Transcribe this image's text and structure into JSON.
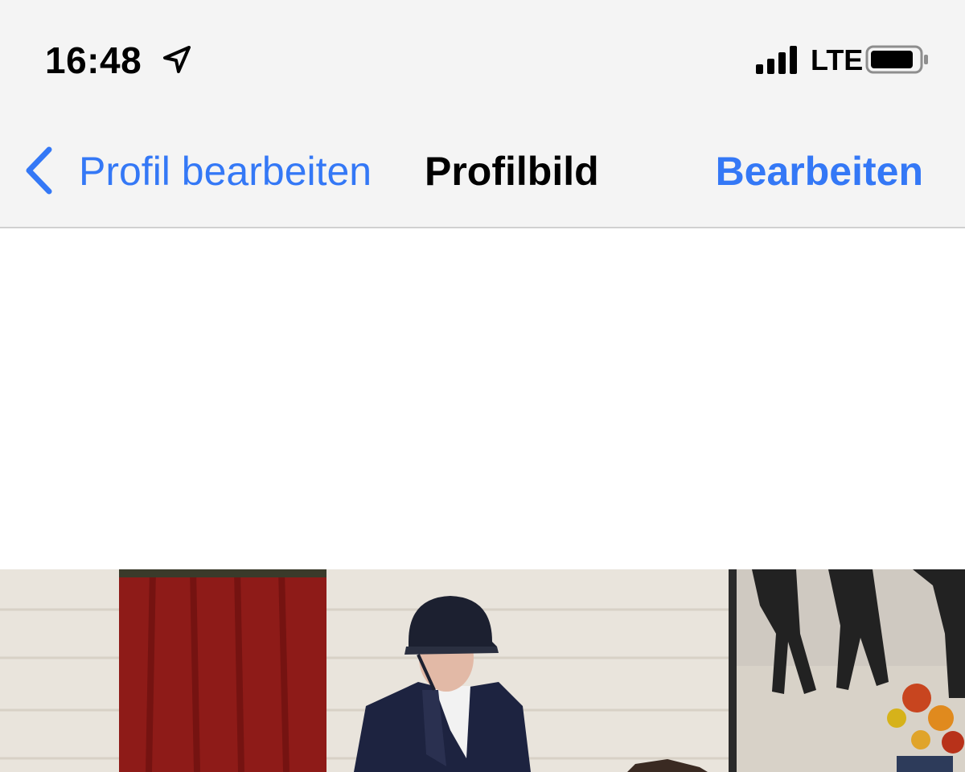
{
  "status_bar": {
    "time": "16:48",
    "location_icon": "location-arrow-icon",
    "signal_icon": "cellular-signal-icon",
    "network": "LTE",
    "battery_icon": "battery-icon"
  },
  "nav": {
    "back_icon": "chevron-left-icon",
    "back_label": "Profil bearbeiten",
    "title": "Profilbild",
    "edit_label": "Bearbeiten"
  },
  "colors": {
    "accent": "#3478f6",
    "bar_background": "#f4f4f4",
    "separator": "#d0d0d0"
  }
}
